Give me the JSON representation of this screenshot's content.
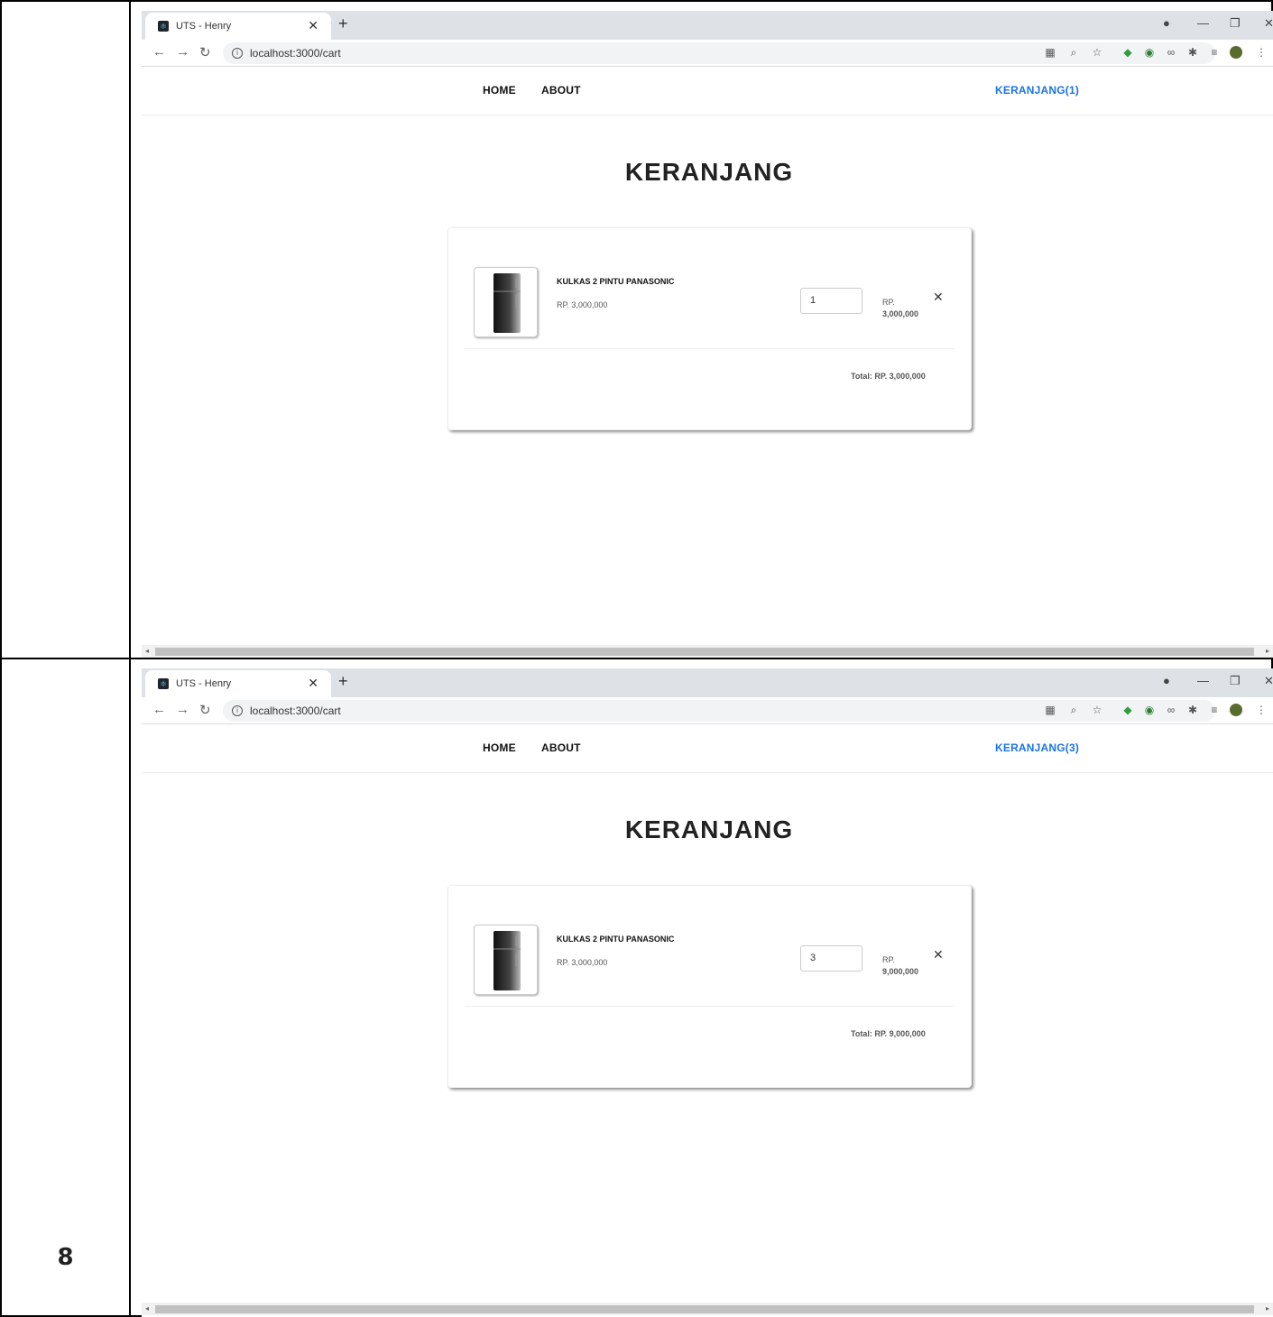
{
  "row_number": "8",
  "shots": [
    {
      "tab_title": "UTS - Henry",
      "url": "localhost:3000/cart",
      "nav": {
        "home": "HOME",
        "about": "ABOUT",
        "cart": "KERANJANG(1)"
      },
      "page_title": "KERANJANG",
      "item": {
        "name": "KULKAS 2 PINTU PANASONIC",
        "price": "RP. 3,000,000",
        "quantity": "1",
        "line_rp": "RP.",
        "line_total": "3,000,000"
      },
      "total": "Total: RP. 3,000,000"
    },
    {
      "tab_title": "UTS - Henry",
      "url": "localhost:3000/cart",
      "nav": {
        "home": "HOME",
        "about": "ABOUT",
        "cart": "KERANJANG(3)"
      },
      "page_title": "KERANJANG",
      "item": {
        "name": "KULKAS 2 PINTU PANASONIC",
        "price": "RP. 3,000,000",
        "quantity": "3",
        "line_rp": "RP.",
        "line_total": "9,000,000"
      },
      "total": "Total: RP. 9,000,000"
    }
  ],
  "icons": {
    "close": "close-icon",
    "add": "plus-icon",
    "remove": "remove-item-icon"
  },
  "colors": {
    "accent": "#1a73e8",
    "tabstrip": "#dee1e6"
  }
}
